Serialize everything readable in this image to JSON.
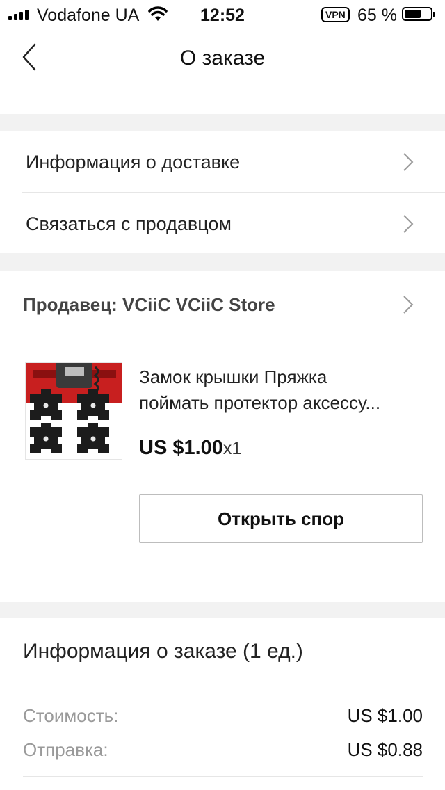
{
  "status_bar": {
    "carrier": "Vodafone UA",
    "time": "12:52",
    "vpn": "VPN",
    "battery": "65 %"
  },
  "header": {
    "title": "О заказе"
  },
  "menu": {
    "delivery_info": "Информация о доставке",
    "contact_seller": "Связаться с продавцом"
  },
  "seller": {
    "label": "Продавец: VCiiC VCiiC Store"
  },
  "product": {
    "title_line1": "Замок крышки Пряжка",
    "title_line2": "поймать протектор аксессу...",
    "price": "US $1.00",
    "quantity": "x1",
    "dispute_button": "Открыть спор"
  },
  "order_info": {
    "title": "Информация о заказе (1 ед.)",
    "rows": [
      {
        "label": "Стоимость:",
        "value": "US $1.00"
      },
      {
        "label": "Отправка:",
        "value": "US $0.88"
      }
    ]
  }
}
